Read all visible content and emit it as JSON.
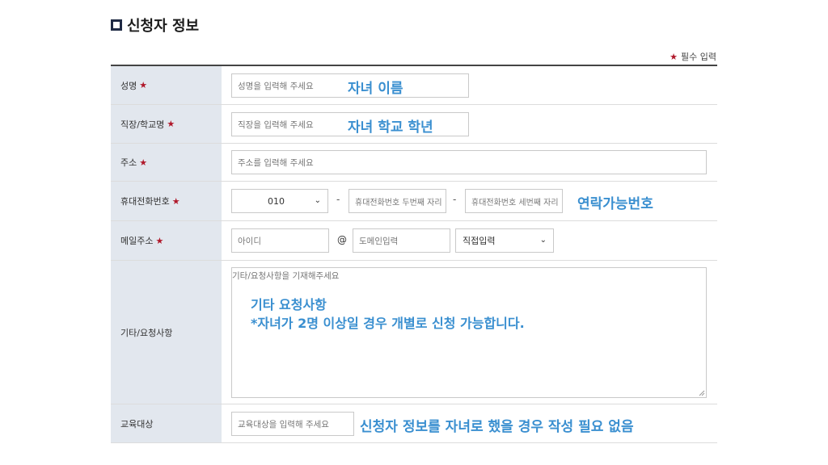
{
  "section": {
    "title": "신청자 정보"
  },
  "required_note": {
    "star": "★",
    "label": "필수 입력"
  },
  "rows": {
    "name": {
      "label": "성명",
      "placeholder": "성명을 입력해 주세요",
      "annotation": "자녀 이름"
    },
    "workplace": {
      "label": "직장/학교명",
      "placeholder": "직장을 입력해 주세요",
      "annotation": "자녀 학교 학년"
    },
    "address": {
      "label": "주소",
      "placeholder": "주소를 입력해 주세요"
    },
    "phone": {
      "label": "휴대전화번호",
      "prefix_value": "010",
      "dash": "-",
      "second_placeholder": "휴대전화번호 두번째 자리",
      "third_placeholder": "휴대전화번호 세번째 자리",
      "annotation": "연락가능번호"
    },
    "email": {
      "label": "메일주소",
      "id_placeholder": "아이디",
      "at": "@",
      "domain_placeholder": "도메인입력",
      "domain_select_value": "직접입력"
    },
    "notes": {
      "label": "기타/요청사항",
      "placeholder": "기타/요청사항을 기재해주세요",
      "annotation_line1": "기타 요청사항",
      "annotation_line2": "*자녀가 2명 이상일 경우 개별로 신청 가능합니다."
    },
    "target": {
      "label": "교육대상",
      "placeholder": "교육대상을 입력해 주세요",
      "annotation": "신청자 정보를 자녀로 했을 경우 작성 필요 없음"
    }
  },
  "colors": {
    "label_bg": "#e2e7ee",
    "required_star": "#b0182a",
    "annotation": "#3a8fd0",
    "title_box": "#1f2a44"
  }
}
